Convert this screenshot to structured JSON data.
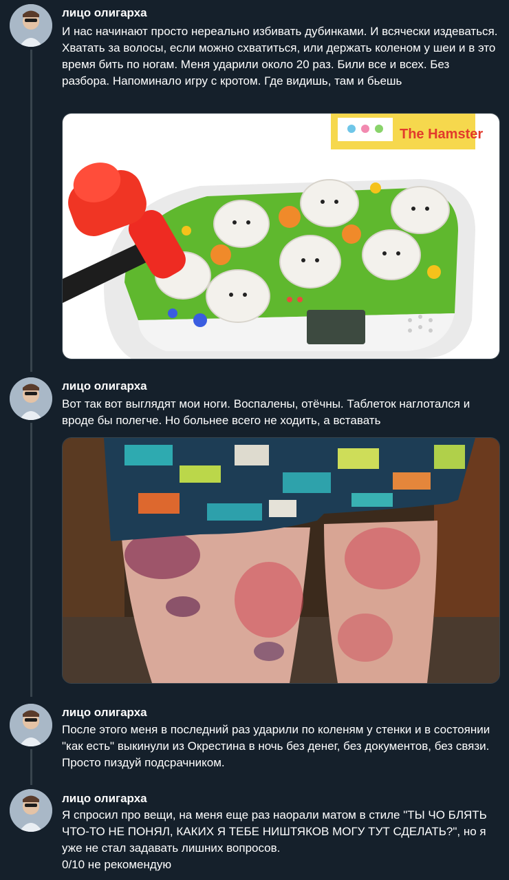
{
  "tweets": [
    {
      "author": "лицо олигарха",
      "text": "И нас начинают просто нереально избивать дубинками. И всячески издеваться. Хватать за волосы, если можно схватиться, или держать коленом у шеи и в это время бить по ногам. Меня ударили около 20 раз. Били все и всех. Без разбора. Напоминало игру с кротом. Где видишь, там и бьешь",
      "media_box_text": "The Hamster"
    },
    {
      "author": "лицо олигарха",
      "text": "Вот так вот выглядят мои ноги. Воспалены, отёчны. Таблеток наглотался и вроде бы полегче. Но больнее всего не ходить, а вставать"
    },
    {
      "author": "лицо олигарха",
      "text": "После этого меня в последний раз ударили по коленям у стенки и в состоянии \"как есть\" выкинули из Окрестина в ночь без денег, без документов, без связи. Просто пиздуй подсрачником."
    },
    {
      "author": "лицо олигарха",
      "text": "Я спросил про вещи, на меня еще раз наорали матом в стиле \"ТЫ ЧО БЛЯТЬ ЧТО-ТО НЕ ПОНЯЛ, КАКИХ Я ТЕБЕ НИШТЯКОВ МОГУ ТУТ СДЕЛАТЬ?\", но я уже не стал задавать лишних вопросов.\n0/10 не рекомендую"
    }
  ],
  "colors": {
    "background": "#15202b",
    "thread_line": "#38444d",
    "text": "#ffffff"
  }
}
